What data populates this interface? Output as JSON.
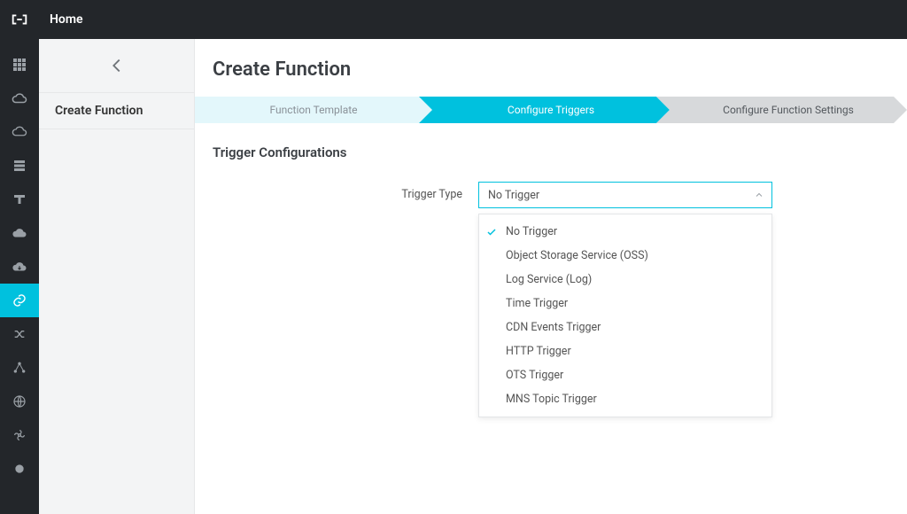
{
  "topbar": {
    "home_label": "Home"
  },
  "sidebar": {
    "active_index": 8,
    "icons": [
      "grid-icon",
      "cloud-outline-icon",
      "cloud-line-icon",
      "rows-icon",
      "t-shape-icon",
      "cloud-solid-icon",
      "cloud-download-icon",
      "link-icon",
      "shuffle-icon",
      "nodes-icon",
      "globe-icon",
      "fan-icon",
      "circle-icon"
    ]
  },
  "secondary": {
    "back_label": "Back",
    "create_function_label": "Create Function"
  },
  "page": {
    "title": "Create Function"
  },
  "wizard": {
    "steps": [
      {
        "label": "Function Template",
        "state": "done"
      },
      {
        "label": "Configure Triggers",
        "state": "active"
      },
      {
        "label": "Configure Function Settings",
        "state": "todo"
      }
    ]
  },
  "section": {
    "title": "Trigger Configurations"
  },
  "form": {
    "trigger_type_label": "Trigger Type",
    "trigger_type_value": "No Trigger",
    "trigger_type_options": [
      "No Trigger",
      "Object Storage Service (OSS)",
      "Log Service (Log)",
      "Time Trigger",
      "CDN Events Trigger",
      "HTTP Trigger",
      "OTS Trigger",
      "MNS Topic Trigger"
    ]
  }
}
